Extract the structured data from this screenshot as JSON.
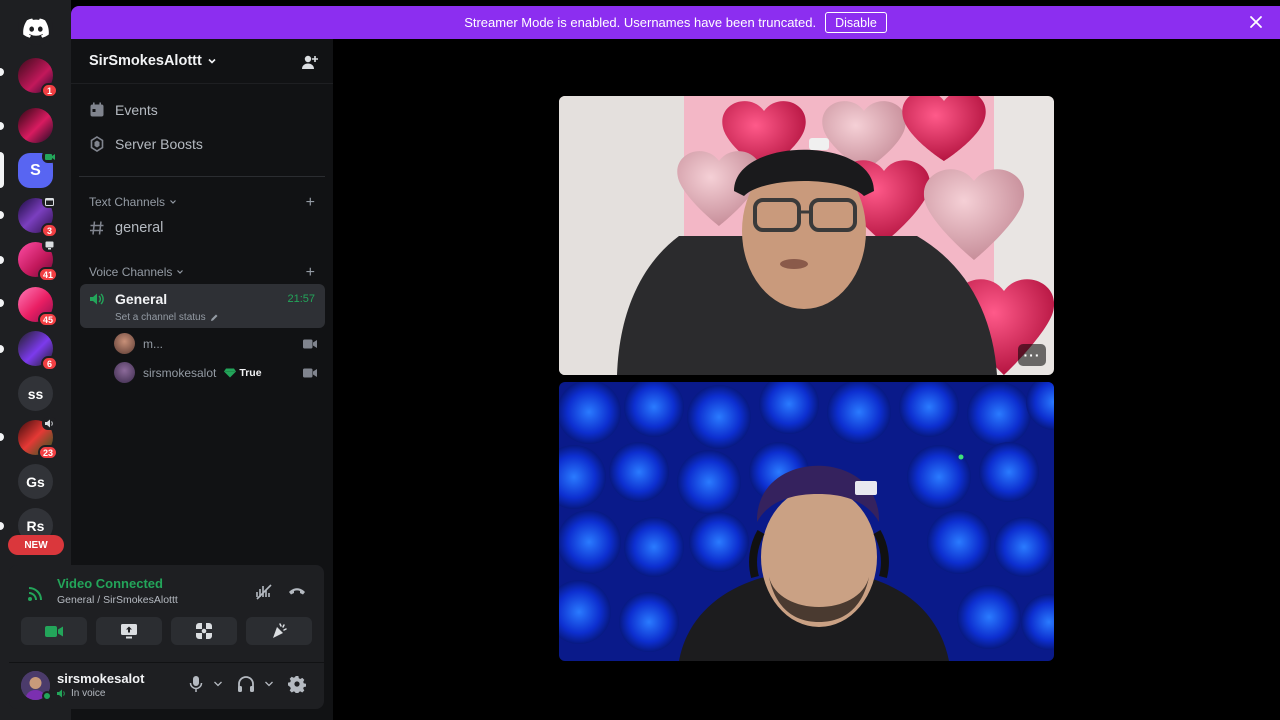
{
  "banner": {
    "message": "Streamer Mode is enabled. Usernames have been truncated.",
    "disable_label": "Disable"
  },
  "rail": {
    "items": [
      {
        "name": "discord-home",
        "badge": ""
      },
      {
        "name": "server-1",
        "badge": "1"
      },
      {
        "name": "server-2",
        "badge": ""
      },
      {
        "name": "server-s",
        "label": "S",
        "badge": ""
      },
      {
        "name": "server-4",
        "badge": "3"
      },
      {
        "name": "server-5",
        "badge": "41"
      },
      {
        "name": "server-6",
        "badge": "45"
      },
      {
        "name": "server-7",
        "badge": "6"
      },
      {
        "name": "server-ss",
        "label": "ss",
        "badge": ""
      },
      {
        "name": "server-9",
        "badge": "23"
      },
      {
        "name": "server-gs",
        "label": "Gs",
        "badge": ""
      },
      {
        "name": "server-rs",
        "label": "Rs",
        "badge": ""
      }
    ],
    "new_label": "NEW"
  },
  "sidebar": {
    "server_name": "SirSmokesAlottt",
    "events_label": "Events",
    "boosts_label": "Server Boosts",
    "text_category": "Text Channels",
    "text_channel": "general",
    "voice_category": "Voice Channels",
    "voice_channel": {
      "name": "General",
      "time": "21:57",
      "status_placeholder": "Set a channel status"
    },
    "voice_users": [
      {
        "name": "m...",
        "tag": ""
      },
      {
        "name": "sirsmokesalot",
        "tag": "True"
      }
    ]
  },
  "voice_panel": {
    "title": "Video Connected",
    "subtitle": "General / SirSmokesAlottt"
  },
  "user": {
    "name": "sirsmokesalot",
    "status": "In voice"
  },
  "stage": {
    "tiles": [
      {
        "name": "video-tile-1",
        "more_label": "···"
      },
      {
        "name": "video-tile-2"
      }
    ]
  },
  "colors": {
    "accent": "#8c2ef0",
    "connected": "#23a55a",
    "badge": "#f23f43"
  }
}
